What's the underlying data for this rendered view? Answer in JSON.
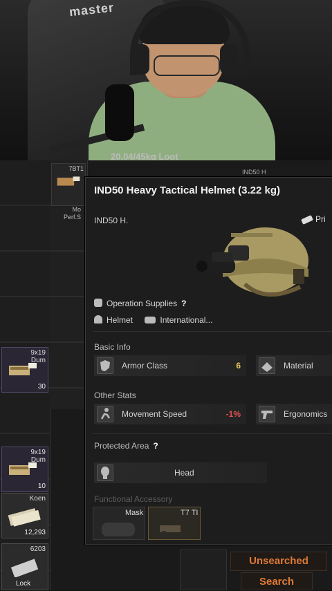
{
  "webcam": {
    "chair_brand": "master",
    "cut_off_text": "20.04/45kg Loot"
  },
  "inventory": {
    "top_cell_label": "7BT1",
    "top_cell_sub": "Mo\nPerf.S",
    "ind_label": "IND50 H",
    "slots": [
      {
        "caliber": "9x19\nDum",
        "count": "30"
      },
      {
        "caliber": "9x19\nDum",
        "count": "10"
      },
      {
        "caliber": "Koen",
        "count": "12,293"
      },
      {
        "caliber": "6203",
        "count": "Lock"
      }
    ]
  },
  "tooltip": {
    "title": "IND50 Heavy Tactical Helmet (3.22 kg)",
    "short_name": "IND50 H.",
    "tag": "Pri",
    "source": "Operation Supplies",
    "help_mark": "?",
    "category": "Helmet",
    "origin": "International...",
    "basic_info_label": "Basic Info",
    "armor_class_label": "Armor Class",
    "armor_class_value": "6",
    "material_label": "Material",
    "other_stats_label": "Other Stats",
    "movement_speed_label": "Movement Speed",
    "movement_speed_value": "-1%",
    "ergonomics_label": "Ergonomics",
    "protected_area_label": "Protected Area",
    "protected_area_help": "?",
    "protected_area_value": "Head",
    "functional_accessory_label": "Functional Accessory",
    "accessory_mask": "Mask",
    "accessory_second": "T7 TI"
  },
  "actions": {
    "unsearched_label": "Unsearched",
    "search_label": "Search"
  },
  "colors": {
    "accent_orange": "#e07a36",
    "value_yellow": "#e6c65a",
    "value_red": "#e05050"
  },
  "icons": {
    "supplies": "box-icon",
    "helmet": "helmet-icon",
    "flag": "flag-icon",
    "armor": "shield-icon",
    "material": "material-icon",
    "speed": "running-person-icon",
    "ergonomics": "pistol-icon",
    "head": "head-icon"
  }
}
